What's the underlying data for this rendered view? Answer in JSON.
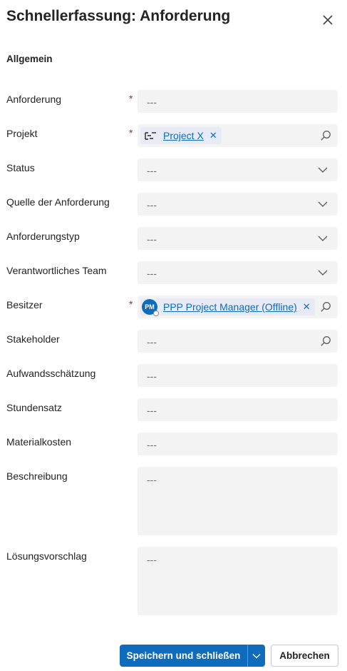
{
  "dialog": {
    "title": "Schnellerfassung: Anforderung",
    "close_icon": "close-icon"
  },
  "section": {
    "title": "Allgemein"
  },
  "fields": [
    {
      "label": "Anforderung",
      "required": true,
      "type": "text",
      "value": "---"
    },
    {
      "label": "Projekt",
      "required": true,
      "type": "lookup",
      "value": "Project X",
      "icon": "project-icon"
    },
    {
      "label": "Status",
      "required": false,
      "type": "select",
      "value": "---"
    },
    {
      "label": "Quelle der Anforderung",
      "required": false,
      "type": "select",
      "value": "---"
    },
    {
      "label": "Anforderungstyp",
      "required": false,
      "type": "select",
      "value": "---"
    },
    {
      "label": "Verantwortliches Team",
      "required": false,
      "type": "select",
      "value": "---"
    },
    {
      "label": "Besitzer",
      "required": true,
      "type": "lookup",
      "value": "PPP Project Manager (Offline)",
      "avatar_initials": "PM"
    },
    {
      "label": "Stakeholder",
      "required": false,
      "type": "lookup",
      "value": "---"
    },
    {
      "label": "Aufwandsschätzung",
      "required": false,
      "type": "text",
      "value": "---"
    },
    {
      "label": "Stundensatz",
      "required": false,
      "type": "text",
      "value": "---"
    },
    {
      "label": "Materialkosten",
      "required": false,
      "type": "text",
      "value": "---"
    },
    {
      "label": "Beschreibung",
      "required": false,
      "type": "textarea",
      "value": "---"
    },
    {
      "label": "Lösungsvorschlag",
      "required": false,
      "type": "textarea",
      "value": "---"
    }
  ],
  "required_marker": "*",
  "remove_tag_glyph": "✕",
  "footer": {
    "save_label": "Speichern und schließen",
    "cancel_label": "Abbrechen"
  },
  "colors": {
    "accent": "#0f6cbd",
    "required": "#a4262c",
    "field_bg": "#f3f3f3"
  }
}
